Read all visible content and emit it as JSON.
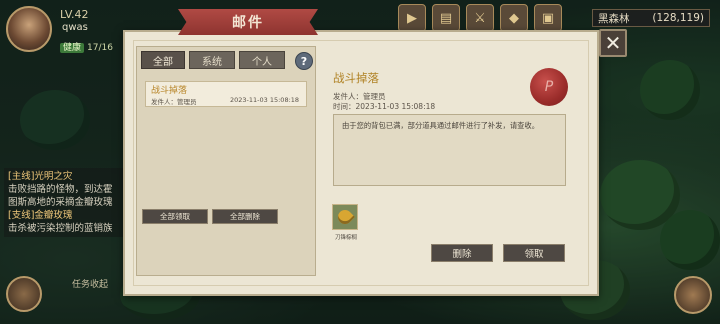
{
  "hud": {
    "level": "LV.42",
    "player_name": "qwas",
    "health_tag": "健康",
    "health_value": "17/16",
    "region_name": "黑森林",
    "coords": "(128,119)",
    "task_toggle_label": "任务收起"
  },
  "quests": [
    {
      "tag": "[主线]",
      "title": "光明之灾",
      "desc": "击败挡路的怪物，到达霍图斯高地的采摘金瓣玫瑰"
    },
    {
      "tag": "[支线]",
      "title": "金瓣玫瑰",
      "desc": "击杀被污染控制的蓝销族"
    }
  ],
  "mail": {
    "window_title": "邮件",
    "tabs": [
      "全部",
      "系统",
      "个人"
    ],
    "help_label": "?",
    "close_label": "✕",
    "list": [
      {
        "title": "战斗掉落",
        "sender": "发件人：管理员",
        "date": "2023-11-03 15:08:18"
      }
    ],
    "claim_all_label": "全部领取",
    "delete_all_label": "全部删除",
    "detail": {
      "title": "战斗掉落",
      "sender": "发件人：管理员",
      "time": "时间：2023-11-03 15:08:18",
      "seal_letter": "P",
      "body": "由于您的背包已满，部分道具通过邮件进行了补发，请查收。",
      "attachment_name": "刀锋棕榈",
      "delete_label": "删除",
      "claim_label": "领取"
    }
  },
  "colors": {
    "ribbon": "#a33e3a",
    "title_gold": "#b08224",
    "button_dark": "#4e4843",
    "panel_bg": "#ece6d4"
  }
}
